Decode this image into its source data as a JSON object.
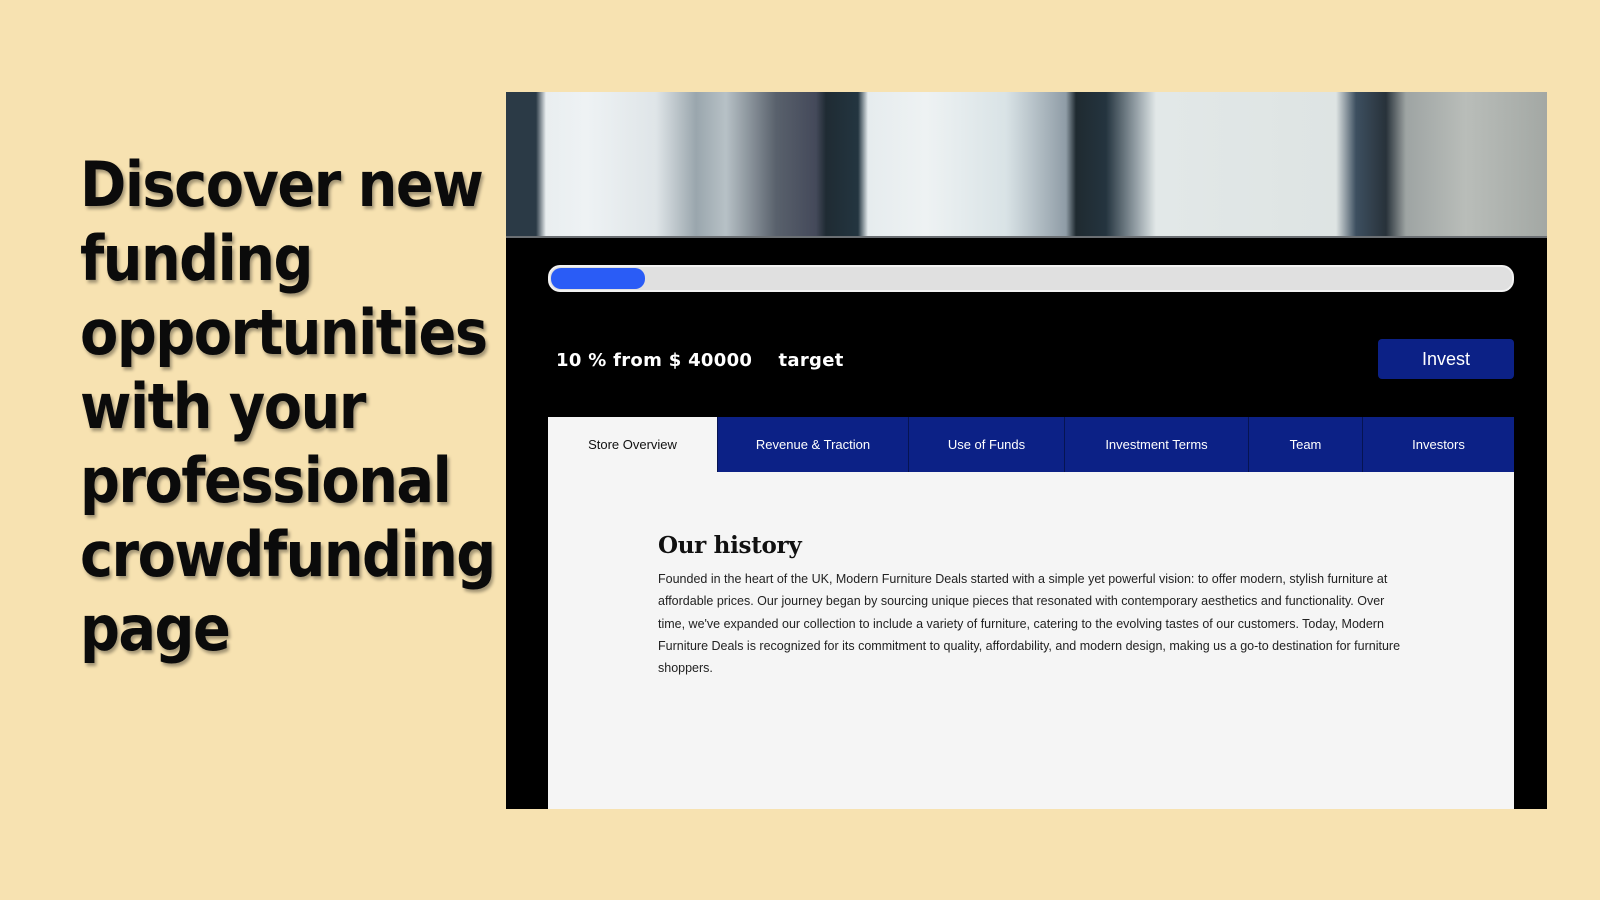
{
  "headline": {
    "lines": [
      "Discover new",
      "funding",
      "opportunities",
      "with your",
      "professional",
      "crowdfunding",
      "page"
    ]
  },
  "campaign": {
    "hero_image": "blurred-office-windows-photo",
    "progress": {
      "percent": 10,
      "fill_color": "#2a5cf6",
      "track_color": "#e0e0e0"
    },
    "funding_text": "10 % from $ 40000    target",
    "invest_button": {
      "label": "Invest",
      "color": "#0c2186"
    },
    "tabs": [
      {
        "label": "Store Overview",
        "active": true
      },
      {
        "label": "Revenue & Traction",
        "active": false
      },
      {
        "label": "Use of Funds",
        "active": false
      },
      {
        "label": "Investment Terms",
        "active": false
      },
      {
        "label": "Team",
        "active": false
      },
      {
        "label": "Investors",
        "active": false
      }
    ],
    "content": {
      "title": "Our history",
      "body": "Founded in the heart of the UK, Modern Furniture Deals started with a simple yet powerful vision: to offer modern, stylish furniture at affordable prices. Our journey began by sourcing unique pieces that resonated with contemporary aesthetics and functionality. Over time, we've expanded our collection to include a variety of furniture, catering to the evolving tastes of our customers. Today, Modern Furniture Deals is recognized for its commitment to quality, affordability, and modern design, making us a go-to destination for furniture shoppers."
    }
  },
  "colors": {
    "page_background": "#f7e2b1",
    "frame_background": "#000000",
    "tab_background": "#0c2186",
    "content_background": "#f5f5f5"
  }
}
